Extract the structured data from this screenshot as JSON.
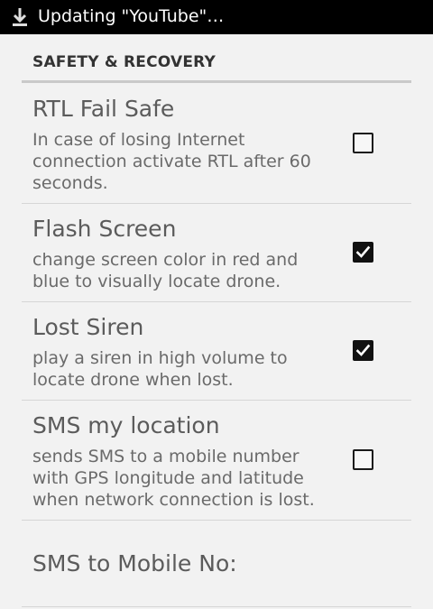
{
  "status_bar": {
    "text": "Updating \"YouTube\"…",
    "icon": "download-icon"
  },
  "section": {
    "title": "SAFETY & RECOVERY"
  },
  "preferences": [
    {
      "title": "RTL Fail Safe",
      "summary": "In case of losing Internet connection activate RTL after 60 seconds.",
      "checked": false
    },
    {
      "title": "Flash Screen",
      "summary": "change screen color in red and blue to visually locate drone.",
      "checked": true
    },
    {
      "title": "Lost Siren",
      "summary": "play a siren in high volume to locate drone when lost.",
      "checked": true
    },
    {
      "title": "SMS my location",
      "summary": "sends SMS to a mobile number with GPS longitude and latitude when network connection is lost.",
      "checked": false
    }
  ],
  "sms_number": {
    "title": "SMS to Mobile No:"
  }
}
